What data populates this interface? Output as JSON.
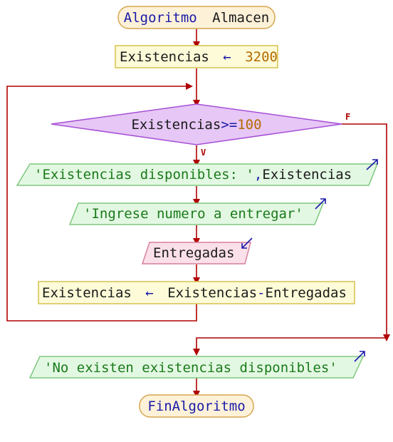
{
  "colors": {
    "arrow": "#b00000",
    "keyword_blue": "#1a1aa8",
    "text_dark": "#1a1a1a",
    "number_orange": "#b36b00",
    "string_green": "#1a7a1a",
    "terminal_fill": "#fdf1d8",
    "terminal_stroke": "#d6a64f",
    "process_fill": "#fdfbd8",
    "process_stroke": "#d6c24f",
    "decision_fill": "#e6c7f5",
    "decision_stroke": "#a64fd6",
    "output_fill": "#e3f8e3",
    "output_stroke": "#7fc77f",
    "input_fill": "#fbe0ea",
    "input_stroke": "#d67f9b"
  },
  "nodes": {
    "start_keyword": "Algoritmo",
    "start_name": "Almacen",
    "assign1_var": "Existencias",
    "assign_arrow": "←",
    "assign1_value": "3200",
    "decision_var": "Existencias",
    "decision_op": ">=",
    "decision_value": "100",
    "branch_true": "V",
    "branch_false": "F",
    "output1_string": "'Existencias disponibles: '",
    "output1_comma": ",",
    "output1_var": "Existencias",
    "output2_string": "'Ingrese numero a entregar'",
    "input_var": "Entregadas",
    "assign2_var": "Existencias",
    "assign2_expr_a": "Existencias",
    "assign2_minus": "-",
    "assign2_expr_b": "Entregadas",
    "output3_string": "'No existen existencias disponibles'",
    "end_keyword": "FinAlgoritmo"
  }
}
